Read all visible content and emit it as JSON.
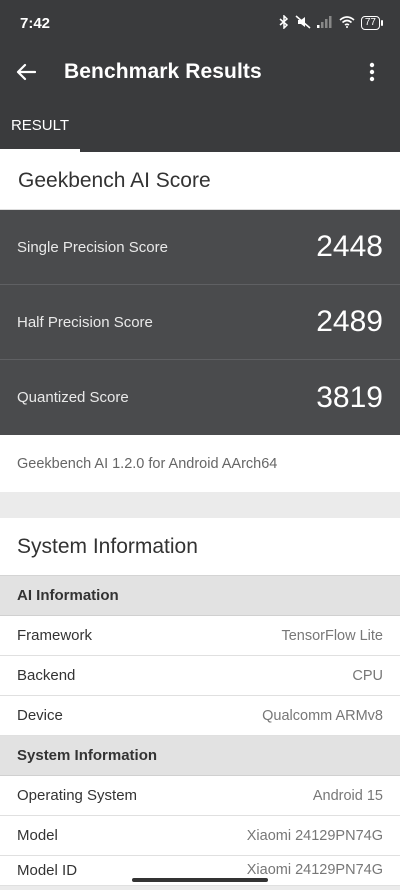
{
  "status": {
    "time": "7:42",
    "battery": "77"
  },
  "appbar": {
    "title": "Benchmark Results"
  },
  "tabs": [
    {
      "label": "RESULT"
    }
  ],
  "score_card": {
    "title": "Geekbench AI Score",
    "rows": [
      {
        "label": "Single Precision Score",
        "value": "2448"
      },
      {
        "label": "Half Precision Score",
        "value": "2489"
      },
      {
        "label": "Quantized Score",
        "value": "3819"
      }
    ],
    "version": "Geekbench AI 1.2.0 for Android AArch64"
  },
  "system": {
    "title": "System Information",
    "ai_header": "AI Information",
    "ai_rows": [
      {
        "label": "Framework",
        "value": "TensorFlow Lite"
      },
      {
        "label": "Backend",
        "value": "CPU"
      },
      {
        "label": "Device",
        "value": "Qualcomm ARMv8"
      }
    ],
    "sys_header": "System Information",
    "sys_rows": [
      {
        "label": "Operating System",
        "value": "Android 15"
      },
      {
        "label": "Model",
        "value": "Xiaomi 24129PN74G"
      },
      {
        "label": "Model ID",
        "value": "Xiaomi 24129PN74G"
      }
    ]
  },
  "icons": {
    "back": "arrow-left",
    "more": "more-vertical",
    "bluetooth": "bluetooth",
    "silent": "mute",
    "signal": "signal",
    "wifi": "wifi",
    "battery": "battery"
  }
}
